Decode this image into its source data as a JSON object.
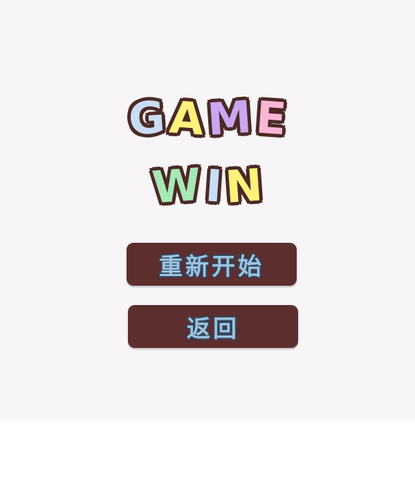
{
  "title": {
    "line1": [
      {
        "char": "G",
        "color": "#c9ddf7"
      },
      {
        "char": "A",
        "color": "#fff27a"
      },
      {
        "char": "M",
        "color": "#c9a7f2"
      },
      {
        "char": "E",
        "color": "#f9b7d6"
      }
    ],
    "line2": [
      {
        "char": "W",
        "color": "#a7e8b7"
      },
      {
        "char": "I",
        "color": "#c9ddf7"
      },
      {
        "char": "N",
        "color": "#fff27a"
      }
    ]
  },
  "buttons": {
    "restart_label": "重新开始",
    "back_label": "返回"
  },
  "colors": {
    "background": "#f7f5f5",
    "button_fill": "#5c2e2e",
    "button_text": "#9fc3df",
    "outline": "#4b2a26"
  }
}
